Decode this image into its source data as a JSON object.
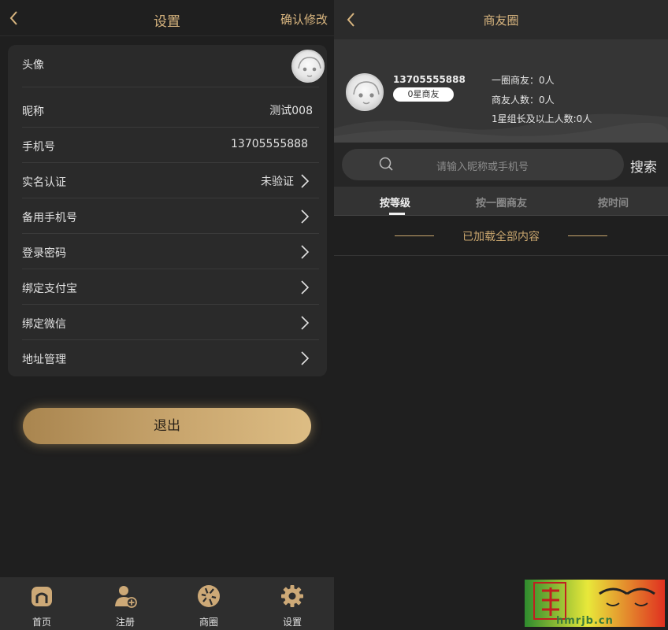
{
  "settings": {
    "title": "设置",
    "confirm_label": "确认修改",
    "rows": [
      {
        "label": "头像",
        "value": ""
      },
      {
        "label": "昵称",
        "value": "测试008"
      },
      {
        "label": "手机号",
        "value": "13705555888"
      },
      {
        "label": "实名认证",
        "value": "未验证"
      },
      {
        "label": "备用手机号",
        "value": ""
      },
      {
        "label": "登录密码",
        "value": ""
      },
      {
        "label": "绑定支付宝",
        "value": ""
      },
      {
        "label": "绑定微信",
        "value": ""
      },
      {
        "label": "地址管理",
        "value": ""
      }
    ],
    "logout_label": "退出"
  },
  "tabbar": {
    "items": [
      {
        "label": "首页",
        "icon": "home-icon"
      },
      {
        "label": "注册",
        "icon": "add-user-icon"
      },
      {
        "label": "商圈",
        "icon": "aperture-icon"
      },
      {
        "label": "设置",
        "icon": "gear-icon"
      }
    ]
  },
  "circle": {
    "title": "商友圈",
    "profile": {
      "phone": "13705555888",
      "badge": "0星商友",
      "stats": [
        "一圈商友：0人",
        "商友人数：0人",
        "1星组长及以上人数:0人"
      ]
    },
    "search": {
      "placeholder": "请输入昵称或手机号",
      "button": "搜索"
    },
    "tabs": [
      "按等级",
      "按一圈商友",
      "按时间"
    ],
    "loaded_text": "已加载全部内容"
  },
  "watermark": {
    "text": "hmrjb.cn"
  },
  "colors": {
    "accent": "#d8b57f",
    "background": "#1f1f1f",
    "card": "#2a2a2a"
  }
}
